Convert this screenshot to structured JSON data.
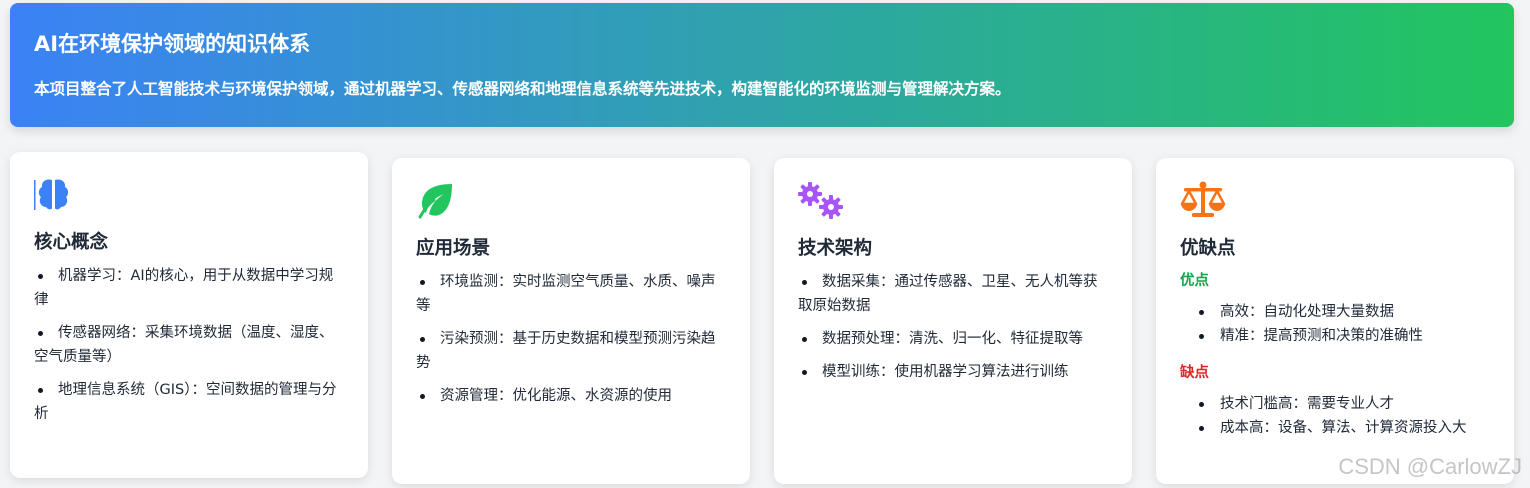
{
  "hero": {
    "title": "AI在环境保护领域的知识体系",
    "description": "本项目整合了人工智能技术与环境保护领域，通过机器学习、传感器网络和地理信息系统等先进技术，构建智能化的环境监测与管理解决方案。"
  },
  "cards": {
    "core": {
      "icon": "brain-icon",
      "title": "核心概念",
      "items": [
        "机器学习：AI的核心，用于从数据中学习规律",
        "传感器网络：采集环境数据（温度、湿度、空气质量等）",
        "地理信息系统（GIS）：空间数据的管理与分析"
      ]
    },
    "scenarios": {
      "icon": "leaf-icon",
      "title": "应用场景",
      "items": [
        "环境监测：实时监测空气质量、水质、噪声等",
        "污染预测：基于历史数据和模型预测污染趋势",
        "资源管理：优化能源、水资源的使用"
      ]
    },
    "architecture": {
      "icon": "gears-icon",
      "title": "技术架构",
      "items": [
        "数据采集：通过传感器、卫星、无人机等获取原始数据",
        "数据预处理：清洗、归一化、特征提取等",
        "模型训练：使用机器学习算法进行训练"
      ]
    },
    "proscons": {
      "icon": "scale-icon",
      "title": "优缺点",
      "pros_label": "优点",
      "pros": [
        "高效：自动化处理大量数据",
        "精准：提高预测和决策的准确性"
      ],
      "cons_label": "缺点",
      "cons": [
        "技术门槛高：需要专业人才",
        "成本高：设备、算法、计算资源投入大"
      ]
    }
  },
  "colors": {
    "gradient_start": "#3b82f6",
    "gradient_end": "#22c55e",
    "brain": "#3b82f6",
    "leaf": "#22c55e",
    "gears": "#a855f7",
    "scale": "#f97316",
    "pros": "#16a34a",
    "cons": "#dc2626"
  },
  "watermark": "CSDN @CarlowZJ"
}
